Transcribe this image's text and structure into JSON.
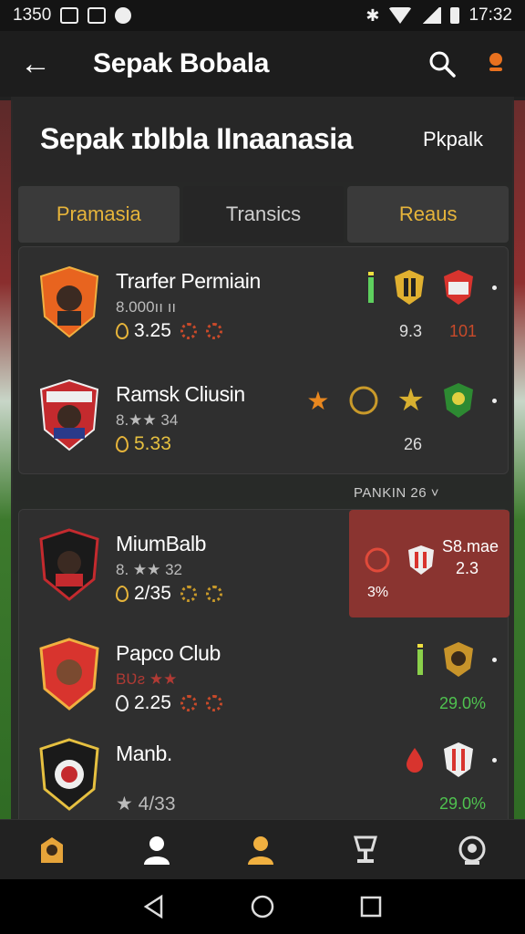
{
  "status_bar": {
    "time_left": "1350",
    "time_right": "17:32"
  },
  "app_bar": {
    "title": "Sepak Bobala",
    "back_icon": "arrow-left-icon",
    "search_icon": "search-icon",
    "alert_icon": "alert-icon"
  },
  "header": {
    "title": "Sepak ɪblbla IInaanasia",
    "right_label": "Pkpalk"
  },
  "tabs": [
    {
      "label": "Pramasia",
      "color": "#e6b43a"
    },
    {
      "label": "Transics",
      "color": "#cfcfcf"
    },
    {
      "label": "Reaus",
      "color": "#e6b43a"
    }
  ],
  "top_rows": [
    {
      "name": "Trarfer Permiain",
      "sub": "8.000ıı ıı",
      "value": "3.25",
      "right_num": "9.3",
      "right_num2": "101",
      "num2_color": "#c84a2a"
    },
    {
      "name": "Ramsk Cliusin",
      "sub": "8.★★ 34",
      "value": "5.33",
      "right_num": "26",
      "right_num2": "",
      "num2_color": "#e0c050"
    }
  ],
  "sort_label": "PANKIN 26 ˅",
  "bottom_rows": [
    {
      "name": "MiumBalb",
      "sub": "8. ★★ 32",
      "value": "2/35",
      "highlight": {
        "line1": "S8.mae",
        "line2": "2.3",
        "line3": "3%"
      }
    },
    {
      "name": "Papco Club",
      "sub": "BƲƨ ★★",
      "value": "2.25",
      "right_num": "29.0%",
      "num_color": "#4fc24f"
    },
    {
      "name": "Manb.",
      "sub": "",
      "value": "★ 4/33",
      "right_num": "29.0%",
      "num_color": "#4fc24f"
    }
  ],
  "bottom_nav": [
    {
      "icon": "home-icon",
      "color": "#e6a43a"
    },
    {
      "icon": "person-icon",
      "color": "#ffffff"
    },
    {
      "icon": "person-active-icon",
      "color": "#f0b040"
    },
    {
      "icon": "trophy-icon",
      "color": "#dddddd"
    },
    {
      "icon": "help-icon",
      "color": "#dddddd"
    }
  ]
}
